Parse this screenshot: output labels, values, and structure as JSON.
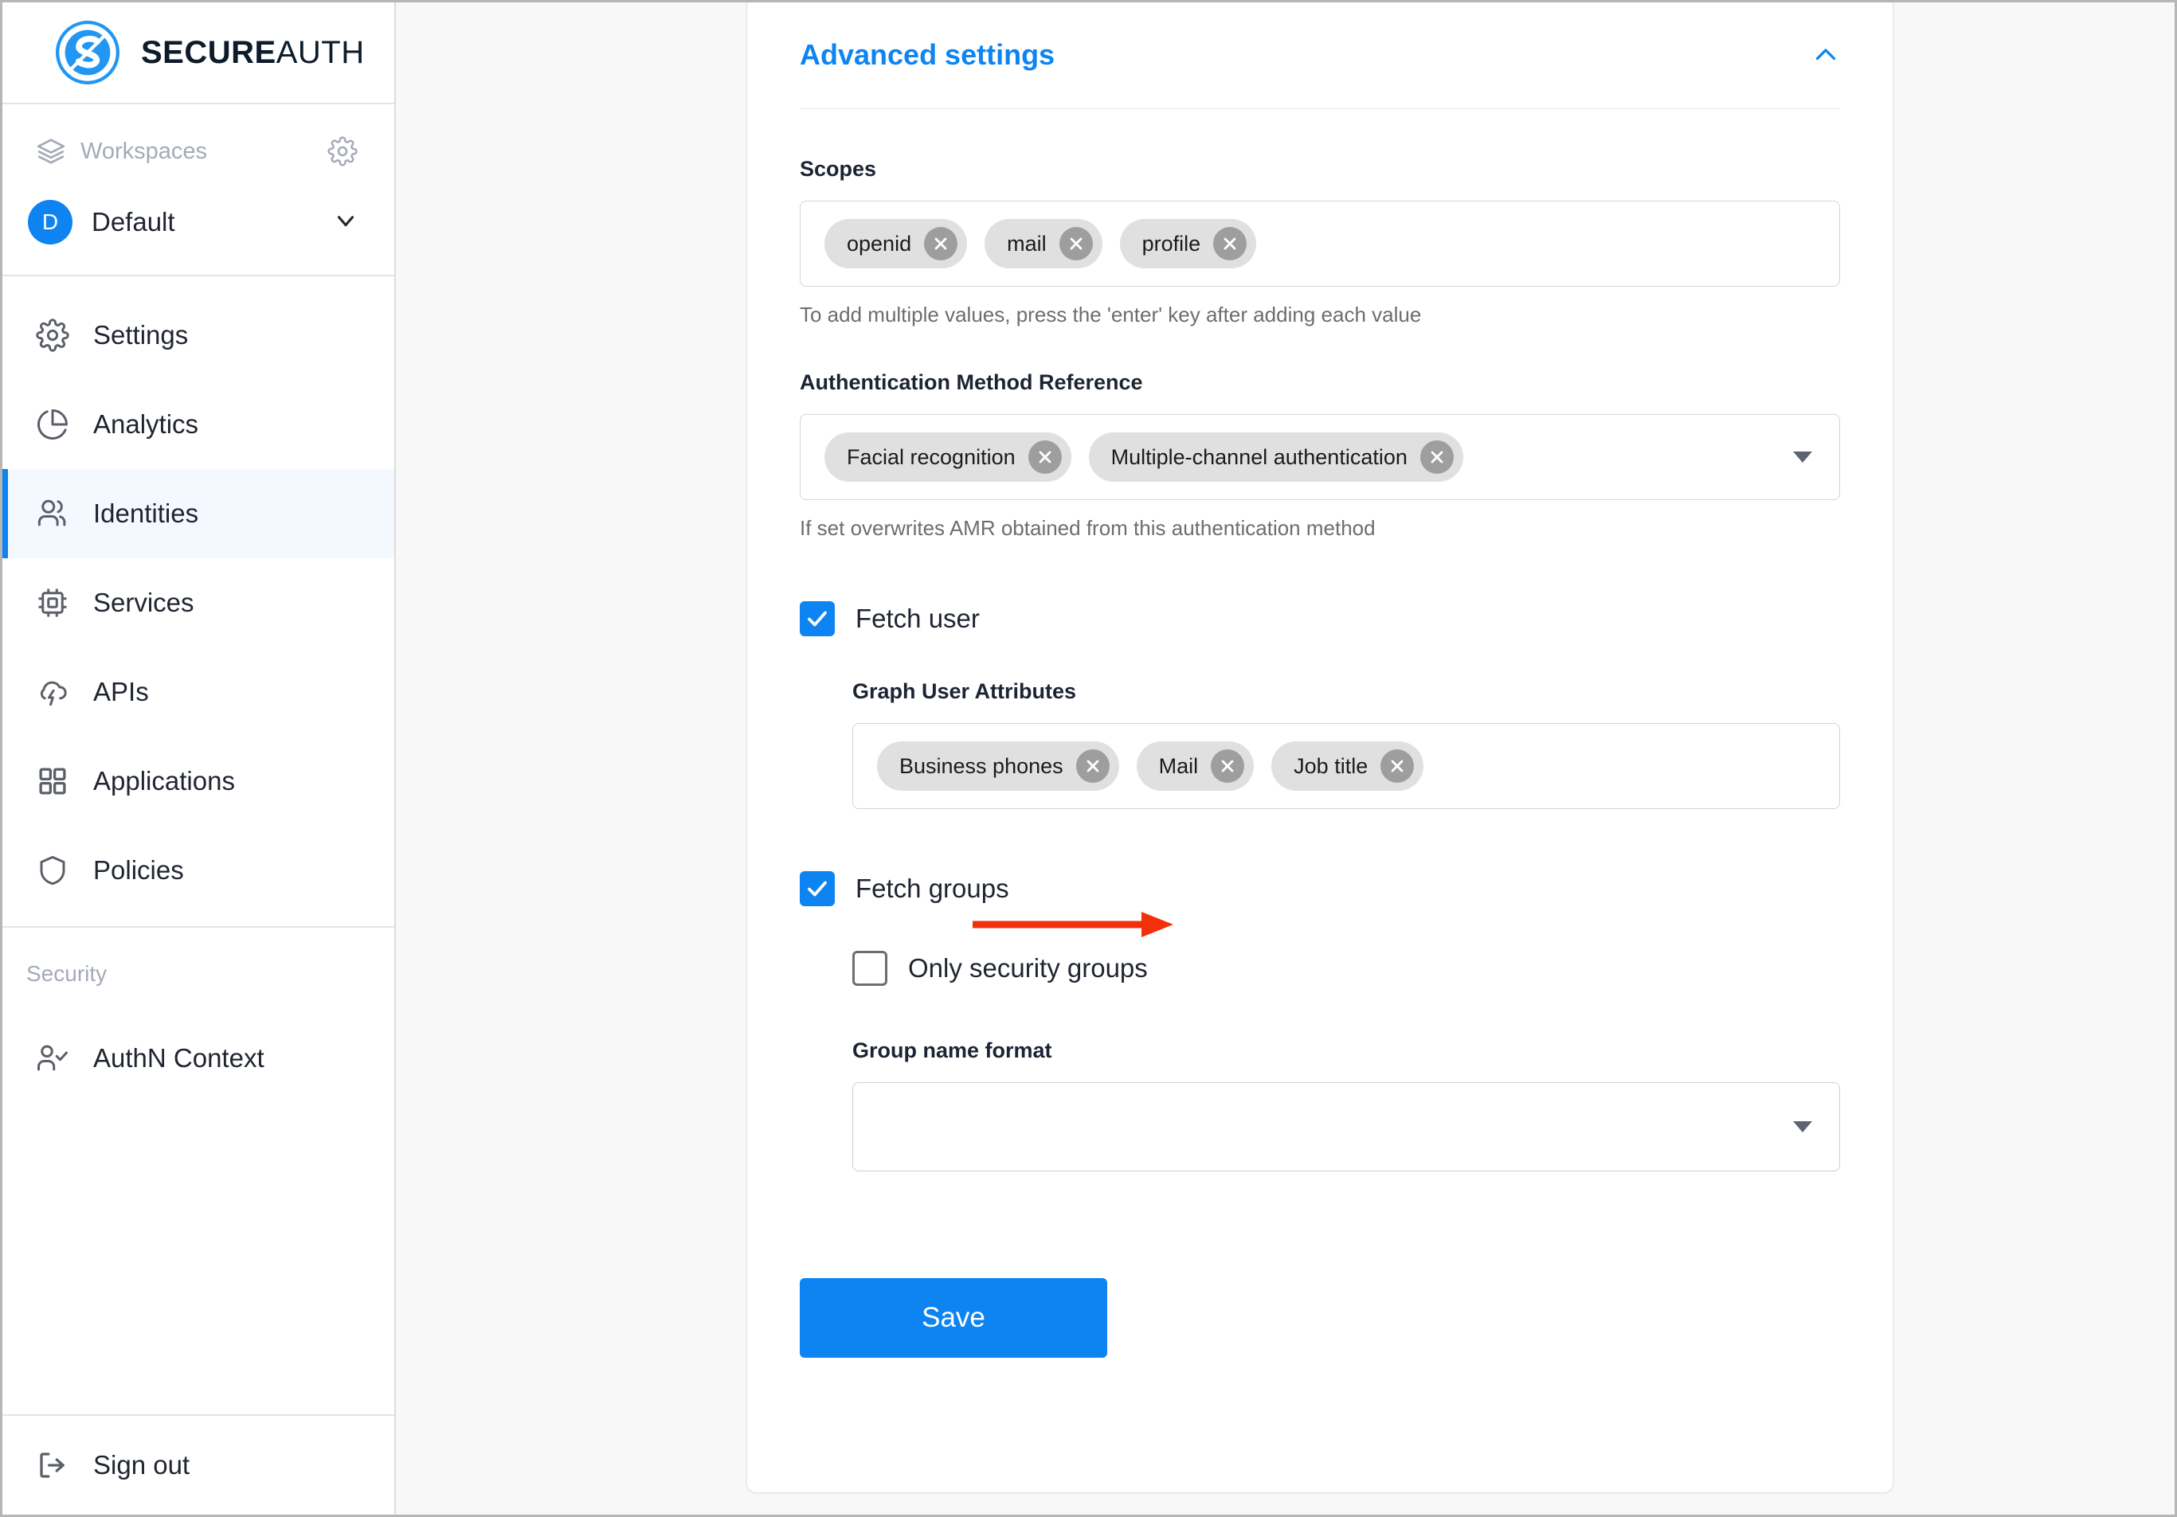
{
  "brand": {
    "name_bold": "SECURE",
    "name_light": "AUTH",
    "logo_icon": "secureauth-s-logo-icon",
    "accent_color": "#0d84f2"
  },
  "sidebar": {
    "workspaces": {
      "label": "Workspaces",
      "icon": "layers-icon",
      "settings_icon": "gear-icon"
    },
    "current_workspace": {
      "initial": "D",
      "name": "Default",
      "chevron_icon": "chevron-down-icon"
    },
    "items": [
      {
        "label": "Settings",
        "icon": "gear-icon",
        "active": false
      },
      {
        "label": "Analytics",
        "icon": "pie-chart-icon",
        "active": false
      },
      {
        "label": "Identities",
        "icon": "users-icon",
        "active": true
      },
      {
        "label": "Services",
        "icon": "chip-icon",
        "active": false
      },
      {
        "label": "APIs",
        "icon": "cloud-bolt-icon",
        "active": false
      },
      {
        "label": "Applications",
        "icon": "grid-icon",
        "active": false
      },
      {
        "label": "Policies",
        "icon": "shield-icon",
        "active": false
      }
    ],
    "security_section": {
      "title": "Security",
      "items": [
        {
          "label": "AuthN Context",
          "icon": "user-check-icon"
        }
      ]
    },
    "sign_out": {
      "label": "Sign out",
      "icon": "sign-out-icon"
    }
  },
  "main": {
    "accordion": {
      "title": "Advanced settings",
      "toggle_icon": "chevron-up-icon",
      "expanded": true
    },
    "scopes": {
      "label": "Scopes",
      "chips": [
        "openid",
        "mail",
        "profile"
      ],
      "hint": "To add multiple values, press the 'enter' key after adding each value",
      "remove_icon": "close-circle-icon"
    },
    "amr": {
      "label": "Authentication Method Reference",
      "chips": [
        "Facial recognition",
        "Multiple-channel authentication"
      ],
      "hint": "If set overwrites AMR obtained from this authentication method",
      "dropdown_icon": "caret-down-icon",
      "remove_icon": "close-circle-icon"
    },
    "fetch_user": {
      "label": "Fetch user",
      "checked": true
    },
    "graph_user_attributes": {
      "label": "Graph User Attributes",
      "chips": [
        "Business phones",
        "Mail",
        "Job title"
      ],
      "remove_icon": "close-circle-icon"
    },
    "fetch_groups": {
      "label": "Fetch groups",
      "checked": true
    },
    "only_security_groups": {
      "label": "Only security groups",
      "checked": false
    },
    "group_name_format": {
      "label": "Group name format",
      "value": "",
      "dropdown_icon": "caret-down-icon"
    },
    "save": {
      "label": "Save",
      "color": "#0d84f2"
    }
  },
  "annotation": {
    "arrow_color": "#f2300c",
    "points_to": "fetch-groups-checkbox"
  }
}
